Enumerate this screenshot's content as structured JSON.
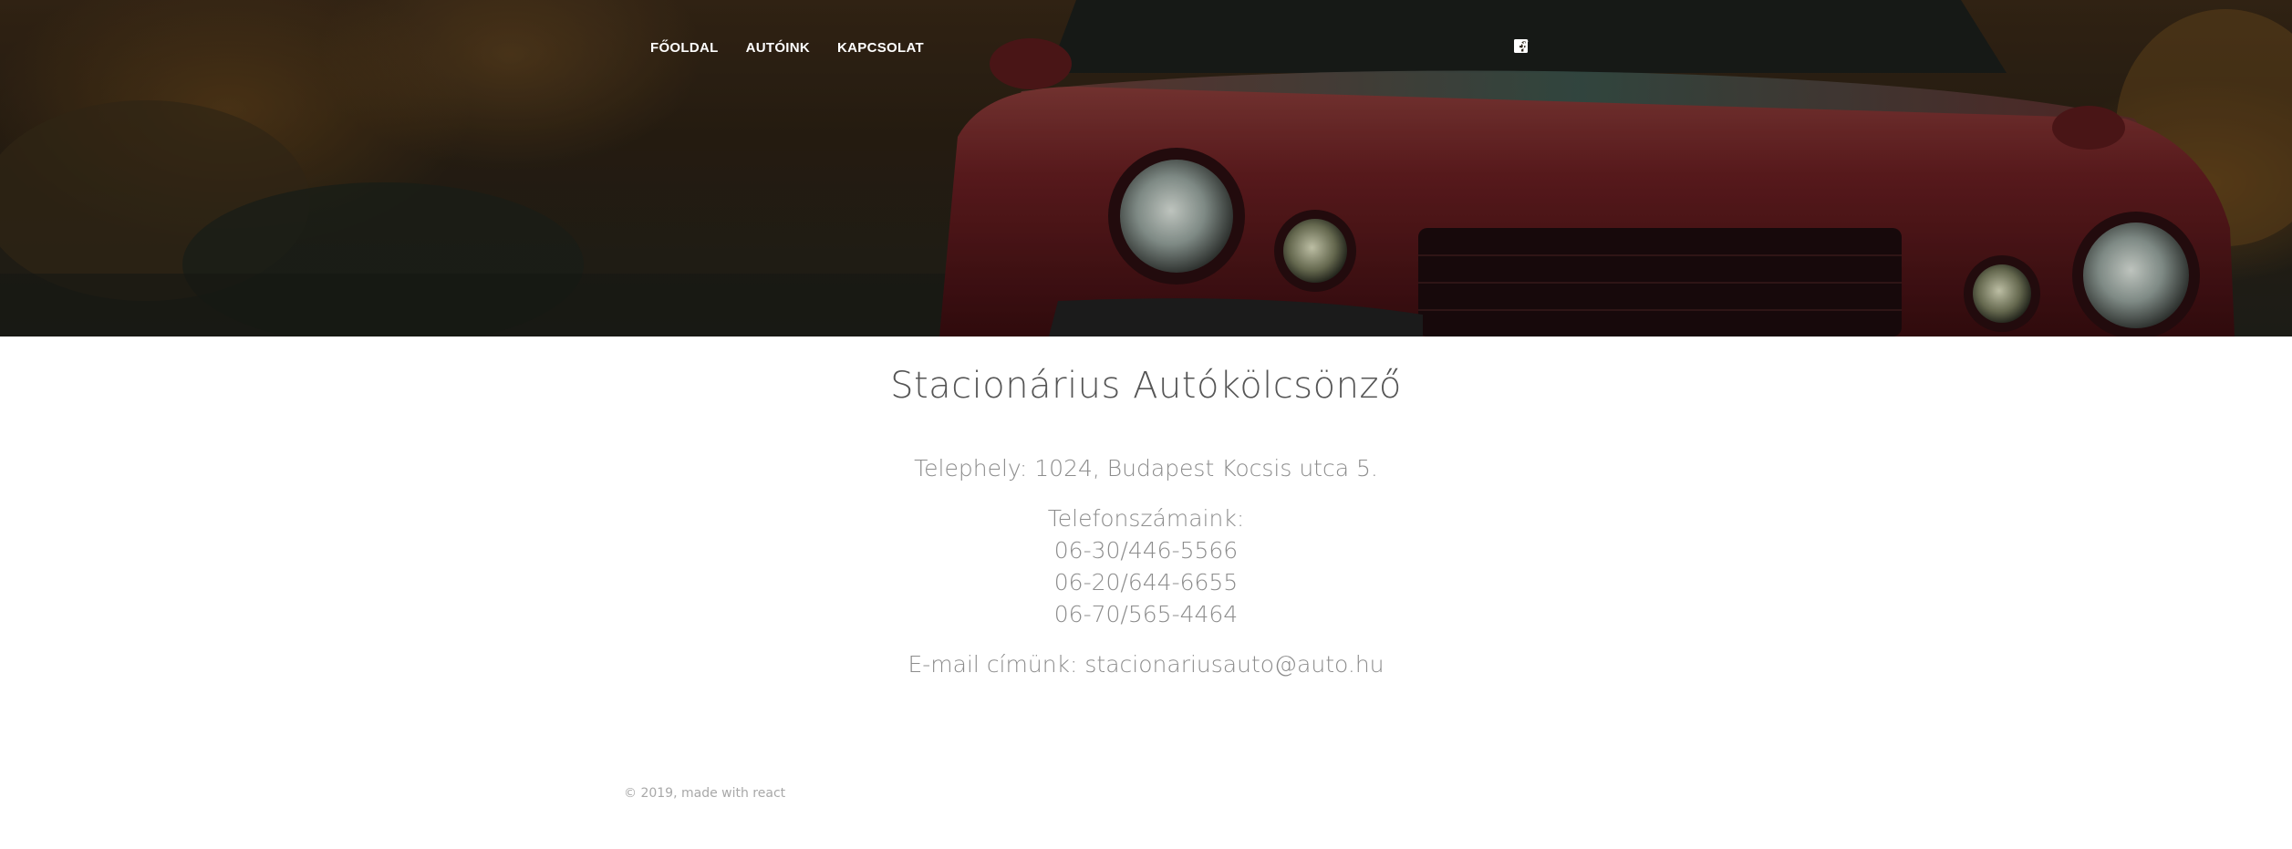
{
  "nav": {
    "links": [
      "FŐOLDAL",
      "AUTÓINK",
      "KAPCSOLAT"
    ]
  },
  "social": {
    "icons": [
      "twitter-icon",
      "facebook-icon",
      "instagram-icon"
    ]
  },
  "content": {
    "title": "Stacionárius Autókölcsönző",
    "address": "Telephely: 1024, Budapest Kocsis utca 5.",
    "phones_label": "Telefonszámaink:",
    "phones": [
      "06-30/446-5566",
      "06-20/644-6655",
      "06-70/565-4464"
    ],
    "email": "E-mail címünk: stacionariusauto@auto.hu"
  },
  "footer": {
    "text": "© 2019, made with react"
  },
  "colors": {
    "title": "#555555",
    "text": "#8c8c8c",
    "footer": "#a8a8a8",
    "nav_text": "#ffffff",
    "car_body": "#6e1f24"
  }
}
